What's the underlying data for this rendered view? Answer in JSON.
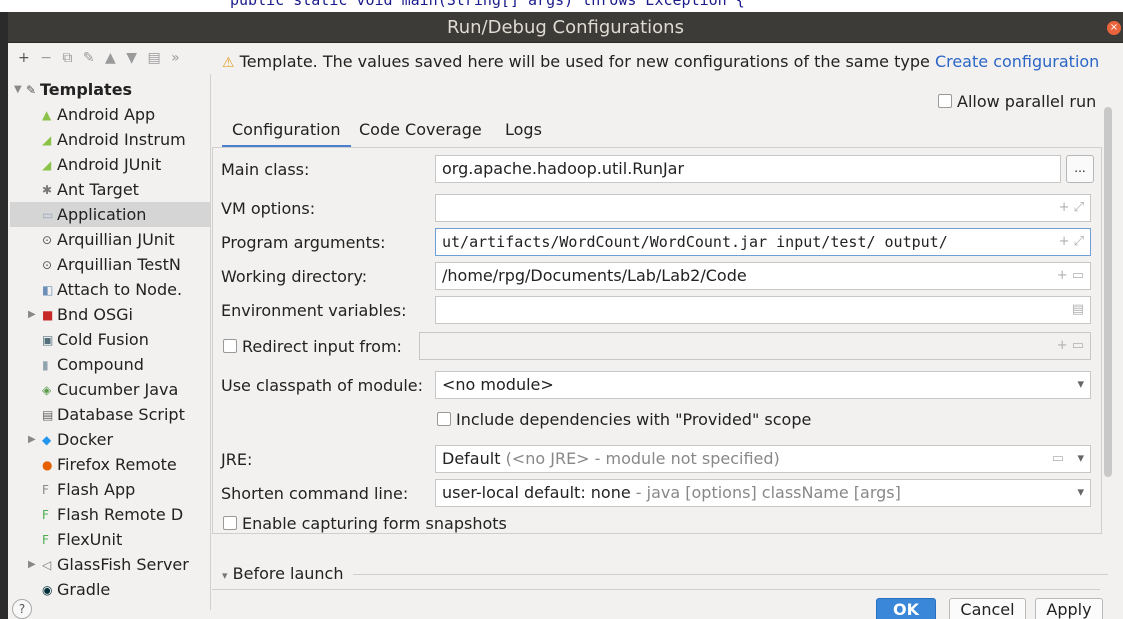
{
  "editor": {
    "code_line": "public static void main(String[] args) throws Exception {"
  },
  "dialog": {
    "title": "Run/Debug Configurations",
    "close_symbol": "×"
  },
  "left_toolbar": {
    "add": "+",
    "remove": "−",
    "copy": "⧉",
    "edit": "✎",
    "up": "▲",
    "down": "▼",
    "folder": "▤",
    "more": "»"
  },
  "tree": {
    "root": "Templates",
    "items": [
      {
        "label": "Android App",
        "icon": "android-icon",
        "color": "#8bc34a"
      },
      {
        "label": "Android Instrum",
        "icon": "android-test-icon",
        "color": "#8bc34a"
      },
      {
        "label": "Android JUnit",
        "icon": "android-test-icon",
        "color": "#8bc34a"
      },
      {
        "label": "Ant Target",
        "icon": "ant-icon",
        "color": "#777777"
      },
      {
        "label": "Application",
        "icon": "application-icon",
        "color": "#9aa7c4",
        "selected": true
      },
      {
        "label": "Arquillian JUnit",
        "icon": "arquillian-icon",
        "color": "#555555"
      },
      {
        "label": "Arquillian TestN",
        "icon": "arquillian-icon",
        "color": "#555555"
      },
      {
        "label": "Attach to Node.",
        "icon": "node-attach-icon",
        "color": "#6c8fb8"
      },
      {
        "label": "Bnd OSGi",
        "icon": "bnd-icon",
        "color": "#c62828",
        "expandable": true
      },
      {
        "label": "Cold Fusion",
        "icon": "coldfusion-icon",
        "color": "#546e7a"
      },
      {
        "label": "Compound",
        "icon": "compound-icon",
        "color": "#90a4ae"
      },
      {
        "label": "Cucumber Java",
        "icon": "cucumber-icon",
        "color": "#5b9b4a"
      },
      {
        "label": "Database Script",
        "icon": "database-script-icon",
        "color": "#666666"
      },
      {
        "label": "Docker",
        "icon": "docker-icon",
        "color": "#2496ed",
        "expandable": true
      },
      {
        "label": "Firefox Remote",
        "icon": "firefox-icon",
        "color": "#e66000"
      },
      {
        "label": "Flash App",
        "icon": "flash-icon",
        "color": "#888888"
      },
      {
        "label": "Flash Remote D",
        "icon": "flash-remote-icon",
        "color": "#4caf50"
      },
      {
        "label": "FlexUnit",
        "icon": "flexunit-icon",
        "color": "#4caf50"
      },
      {
        "label": "GlassFish Server",
        "icon": "glassfish-icon",
        "color": "#777777",
        "expandable": true
      },
      {
        "label": "Gradle",
        "icon": "gradle-icon",
        "color": "#02303a"
      }
    ]
  },
  "warning": {
    "icon": "⚠",
    "text": "Template. The values saved here will be used for new configurations of the same type",
    "link": "Create configuration"
  },
  "allow_parallel": {
    "label": "Allow parallel run",
    "checked": false
  },
  "tabs": [
    {
      "label": "Configuration",
      "active": true
    },
    {
      "label": "Code Coverage",
      "active": false
    },
    {
      "label": "Logs",
      "active": false
    }
  ],
  "form": {
    "main_class": {
      "label": "Main class:",
      "value": "org.apache.hadoop.util.RunJar",
      "button": "..."
    },
    "vm_options": {
      "label": "VM options:",
      "value": "",
      "icons": "+ ⤢"
    },
    "program_arguments": {
      "label": "Program arguments:",
      "value": "ut/artifacts/WordCount/WordCount.jar input/test/ output/",
      "icons": "+ ⤢"
    },
    "working_directory": {
      "label": "Working directory:",
      "value": "/home/rpg/Documents/Lab/Lab2/Code",
      "icons": "+ ▭"
    },
    "environment_variables": {
      "label": "Environment variables:",
      "value": "",
      "icons": "▤"
    },
    "redirect_input": {
      "label": "Redirect input from:",
      "checked": false,
      "value": "",
      "icons": "+ ▭"
    },
    "classpath_module": {
      "label": "Use classpath of module:",
      "value": "<no module>",
      "arrow": "▾"
    },
    "include_provided": {
      "label": "Include dependencies with \"Provided\" scope",
      "checked": false
    },
    "jre": {
      "label": "JRE:",
      "value": "Default",
      "hint": "(<no JRE> - module not specified)",
      "arrow": "▾",
      "folder": "▭"
    },
    "shorten_command": {
      "label": "Shorten command line:",
      "value": "user-local default: none",
      "hint": "- java [options] className [args]",
      "arrow": "▾"
    },
    "capture_snapshots": {
      "label": "Enable capturing form snapshots",
      "checked": false
    }
  },
  "before_launch": {
    "arrow": "▾",
    "label": "Before launch"
  },
  "help": "?",
  "buttons": {
    "ok": "OK",
    "cancel": "Cancel",
    "apply": "Apply"
  }
}
